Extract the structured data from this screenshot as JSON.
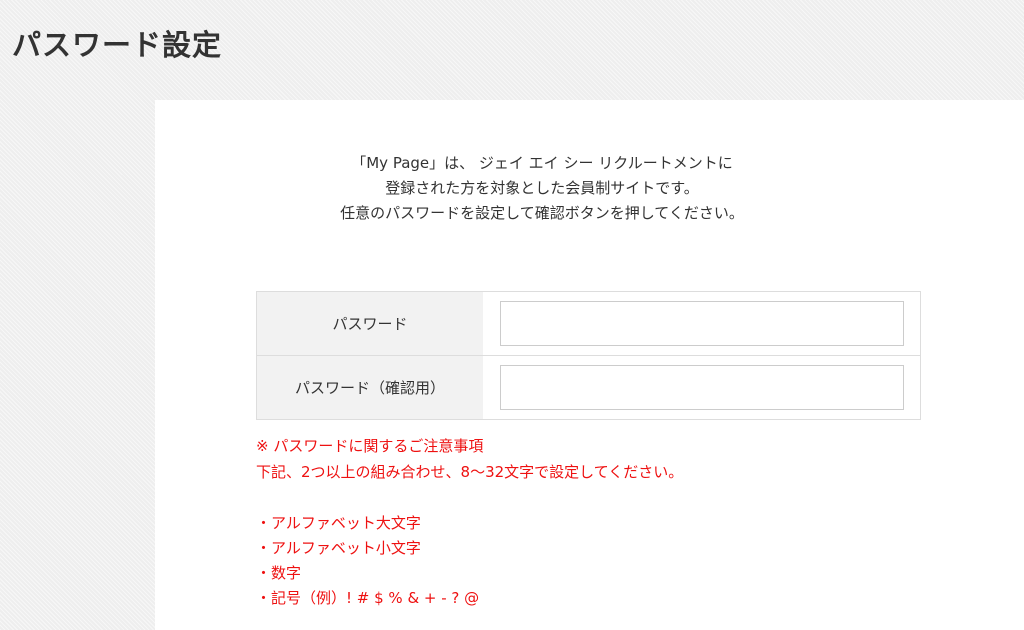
{
  "page_title": "パスワード設定",
  "intro": {
    "lines": [
      "「My Page」は、 ジェイ エイ シー リクルートメントに",
      "登録された方を対象とした会員制サイトです。",
      "任意のパスワードを設定して確認ボタンを押してください。"
    ]
  },
  "form": {
    "password_label": "パスワード",
    "password_value": "",
    "password_confirm_label": "パスワード（確認用）",
    "password_confirm_value": ""
  },
  "notes": {
    "heading": "※ パスワードに関するご注意事項",
    "description": "下記、2つ以上の組み合わせ、8～32文字で設定してください。",
    "rules": [
      "・アルファベット大文字",
      "・アルファベット小文字",
      "・数字",
      "・記号（例）! # $ % & + - ? @"
    ]
  },
  "colors": {
    "background": "#eeeeee",
    "card": "#ffffff",
    "label_background": "#f2f2f2",
    "border": "#dddddd",
    "text": "#333333",
    "warning": "#ee1111"
  }
}
